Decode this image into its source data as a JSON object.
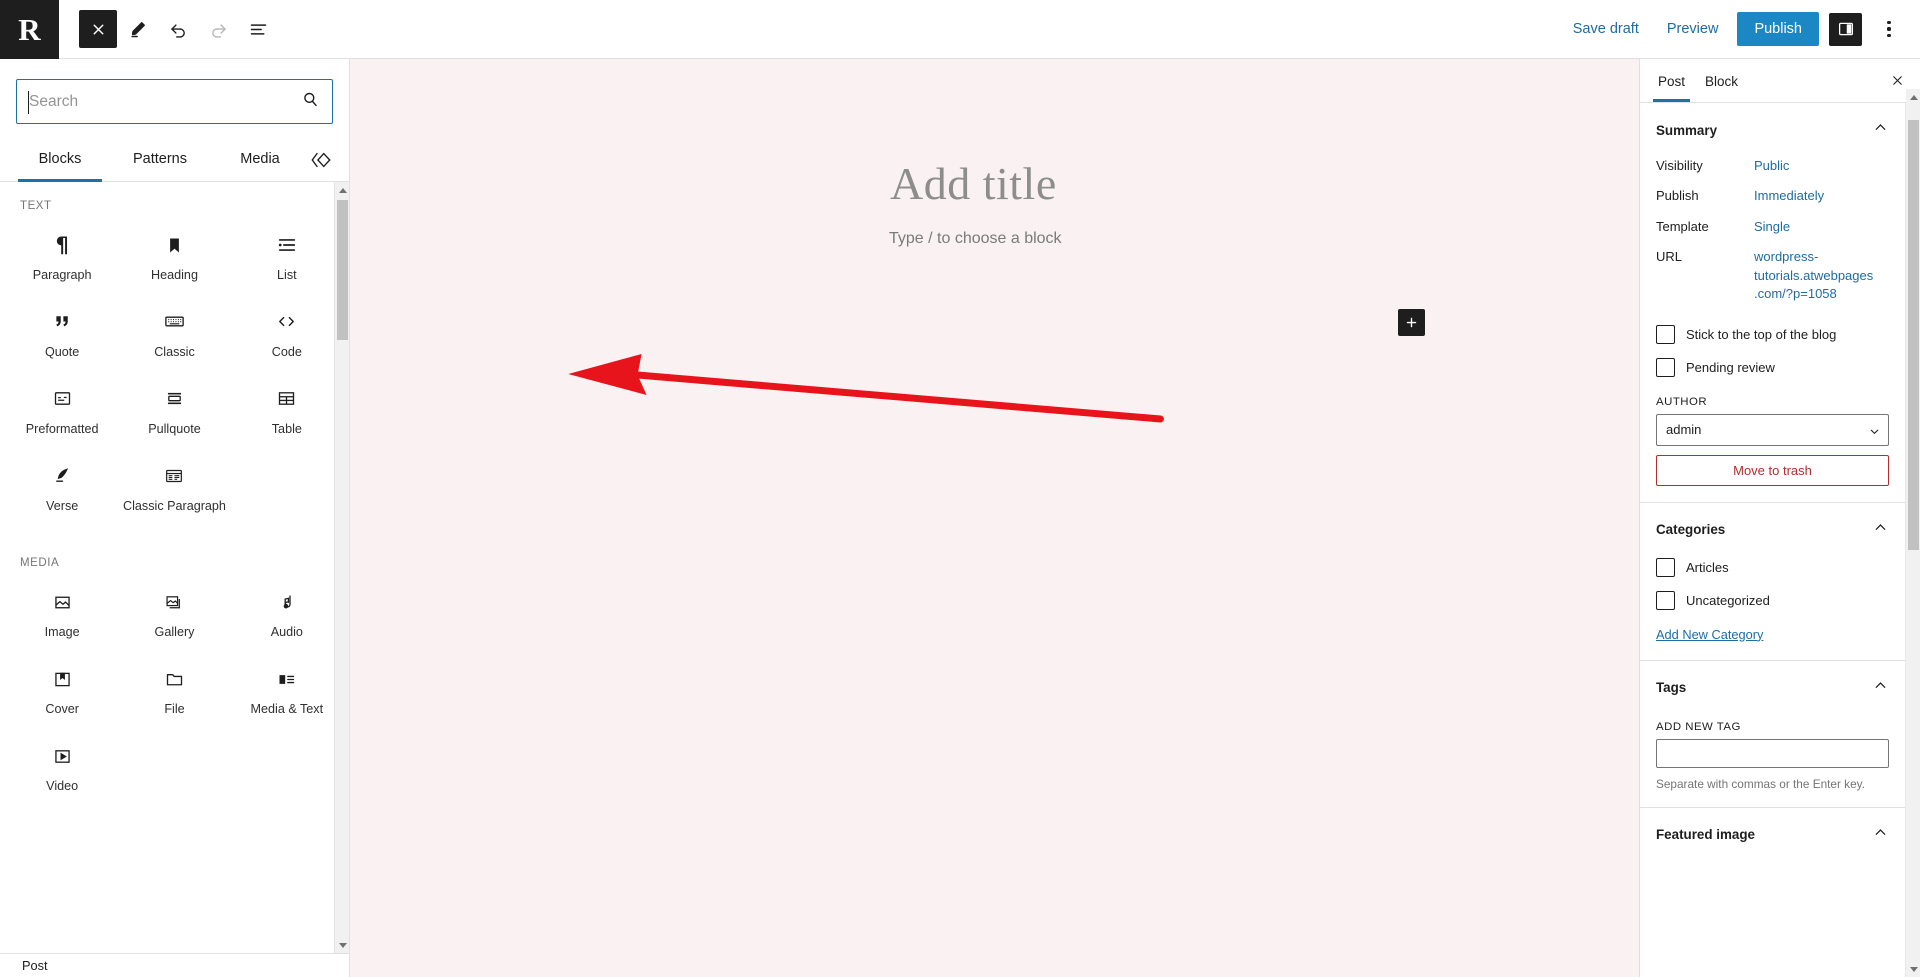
{
  "colors": {
    "accent": "#1b72a8",
    "publish_button": "#1b87c4",
    "danger": "#b32d2e",
    "canvas_bg": "#faf2f2",
    "toolbar_dark": "#1e1e1e",
    "annotation_arrow": "#e8141b"
  },
  "topbar": {
    "logo_letter": "R",
    "close_icon": "close-icon",
    "edit_icon": "pencil-edit-icon",
    "undo_icon": "undo-icon",
    "redo_icon": "redo-icon",
    "details_icon": "document-overview-icon",
    "save_draft_label": "Save draft",
    "preview_label": "Preview",
    "publish_label": "Publish",
    "sidebar_toggle_icon": "sidebar-toggle-icon",
    "options_icon": "kebab-menu-icon"
  },
  "inserter": {
    "search": {
      "value": "",
      "placeholder": "Search"
    },
    "search_icon": "search-icon",
    "tabs": [
      {
        "label": "Blocks",
        "active": true
      },
      {
        "label": "Patterns",
        "active": false
      },
      {
        "label": "Media",
        "active": false
      }
    ],
    "reusable_icon": "reusable-blocks-icon",
    "sections": [
      {
        "title": "TEXT",
        "blocks": [
          {
            "label": "Paragraph",
            "icon": "paragraph-icon",
            "glyph": "¶"
          },
          {
            "label": "Heading",
            "icon": "heading-bookmark-icon",
            "glyph": ""
          },
          {
            "label": "List",
            "icon": "list-icon",
            "glyph": ""
          },
          {
            "label": "Quote",
            "icon": "quote-icon",
            "glyph": "”"
          },
          {
            "label": "Classic",
            "icon": "classic-keyboard-icon",
            "glyph": ""
          },
          {
            "label": "Code",
            "icon": "code-icon",
            "glyph": "‹›"
          },
          {
            "label": "Preformatted",
            "icon": "preformatted-icon",
            "glyph": ""
          },
          {
            "label": "Pullquote",
            "icon": "pullquote-icon",
            "glyph": ""
          },
          {
            "label": "Table",
            "icon": "table-icon",
            "glyph": ""
          },
          {
            "label": "Verse",
            "icon": "verse-quill-icon",
            "glyph": ""
          },
          {
            "label": "Classic Paragraph",
            "icon": "classic-paragraph-icon",
            "glyph": ""
          }
        ]
      },
      {
        "title": "MEDIA",
        "blocks": [
          {
            "label": "Image",
            "icon": "image-icon",
            "glyph": ""
          },
          {
            "label": "Gallery",
            "icon": "gallery-icon",
            "glyph": ""
          },
          {
            "label": "Audio",
            "icon": "audio-note-icon",
            "glyph": "♪"
          },
          {
            "label": "Cover",
            "icon": "cover-icon",
            "glyph": ""
          },
          {
            "label": "File",
            "icon": "file-folder-icon",
            "glyph": ""
          },
          {
            "label": "Media & Text",
            "icon": "media-and-text-icon",
            "glyph": ""
          },
          {
            "label": "Video",
            "icon": "video-play-icon",
            "glyph": ""
          }
        ]
      }
    ],
    "breadcrumb": "Post"
  },
  "canvas": {
    "title_placeholder": "Add title",
    "paragraph_placeholder": "Type / to choose a block",
    "add_block_icon": "plus-icon"
  },
  "sidebar": {
    "tabs": [
      {
        "label": "Post",
        "active": true
      },
      {
        "label": "Block",
        "active": false
      }
    ],
    "close_icon": "close-icon",
    "summary": {
      "title": "Summary",
      "chevron": "chevron-up-icon",
      "rows": [
        {
          "label": "Visibility",
          "value": "Public"
        },
        {
          "label": "Publish",
          "value": "Immediately"
        },
        {
          "label": "Template",
          "value": "Single"
        },
        {
          "label": "URL",
          "value": "wordpress-tutorials.atwebpages.com/?p=1058"
        }
      ],
      "checkboxes": [
        {
          "label": "Stick to the top of the blog",
          "checked": false
        },
        {
          "label": "Pending review",
          "checked": false
        }
      ],
      "author_label": "AUTHOR",
      "author_value": "admin",
      "author_options": [
        "admin"
      ],
      "trash_label": "Move to trash"
    },
    "categories": {
      "title": "Categories",
      "chevron": "chevron-up-icon",
      "items": [
        {
          "label": "Articles",
          "checked": false
        },
        {
          "label": "Uncategorized",
          "checked": false
        }
      ],
      "add_link": "Add New Category"
    },
    "tags": {
      "title": "Tags",
      "chevron": "chevron-up-icon",
      "field_label": "ADD NEW TAG",
      "input_value": "",
      "helper": "Separate with commas or the Enter key."
    },
    "featured_image": {
      "title": "Featured image",
      "chevron": "chevron-up-icon"
    }
  }
}
